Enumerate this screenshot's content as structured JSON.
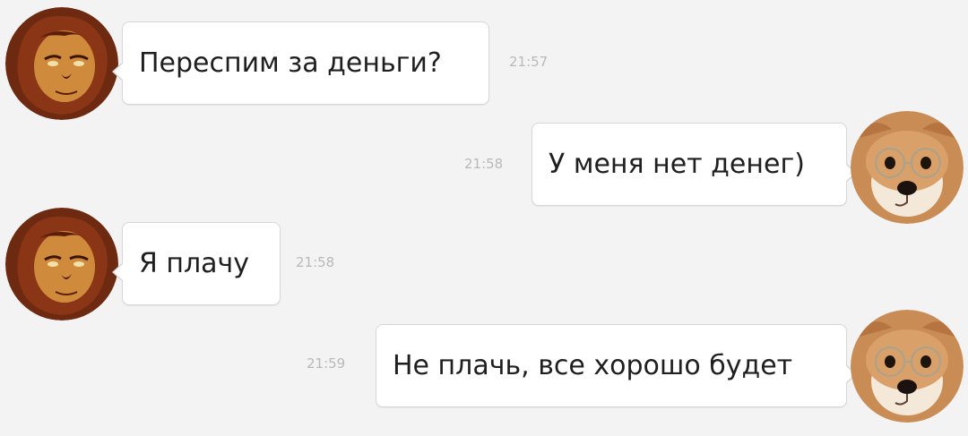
{
  "conversation": {
    "messages": [
      {
        "text": "Переспим за деньги?",
        "time": "21:57",
        "direction": "incoming",
        "avatar_icon": "lion-avatar-icon"
      },
      {
        "text": "У меня нет денег)",
        "time": "21:58",
        "direction": "outgoing",
        "avatar_icon": "dog-with-glasses-avatar-icon"
      },
      {
        "text": "Я плачу",
        "time": "21:58",
        "direction": "incoming",
        "avatar_icon": "lion-avatar-icon"
      },
      {
        "text": "Не плачь, все хорошо будет",
        "time": "21:59",
        "direction": "outgoing",
        "avatar_icon": "dog-with-glasses-avatar-icon"
      }
    ]
  },
  "colors": {
    "background": "#f3f3f3",
    "bubble": "#ffffff",
    "bubble_border": "#d7d7d7",
    "timestamp": "#b9b9b9",
    "text": "#1f1f1f"
  }
}
